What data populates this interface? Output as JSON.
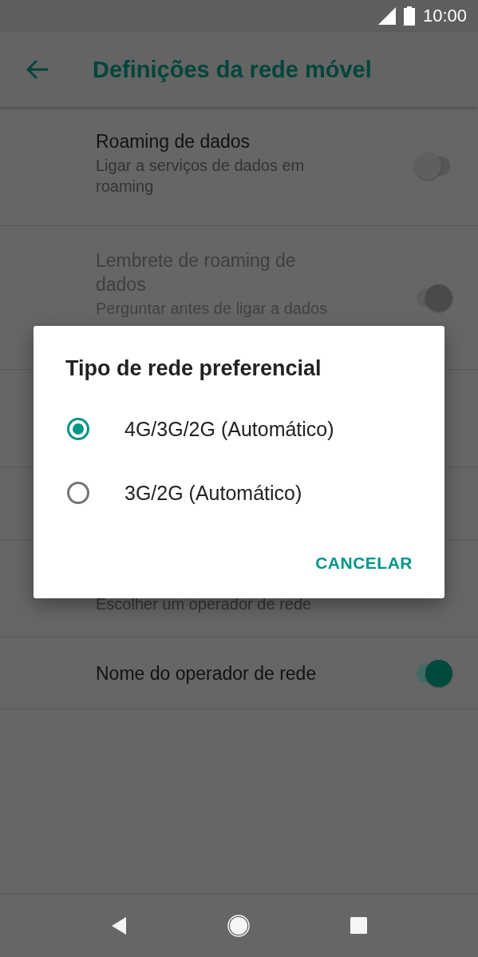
{
  "status_bar": {
    "time": "10:00"
  },
  "app_bar": {
    "title": "Definições da rede móvel"
  },
  "settings": [
    {
      "title": "Roaming de dados",
      "subtitle": "Ligar a serviços de dados em roaming",
      "on": false,
      "disabled": false
    },
    {
      "title": "Lembrete de roaming de dados",
      "subtitle": "Perguntar antes de ligar a dados",
      "on": true,
      "disabled": true
    },
    {
      "subtitle": "Escolher um operador de rede"
    },
    {
      "title": "Nome do operador de rede",
      "on": true,
      "disabled": false
    }
  ],
  "dialog": {
    "title": "Tipo de rede preferencial",
    "options": [
      {
        "label": "4G/3G/2G (Automático)",
        "selected": true
      },
      {
        "label": "3G/2G (Automático)",
        "selected": false
      }
    ],
    "buttons": [
      "CANCELAR"
    ]
  }
}
